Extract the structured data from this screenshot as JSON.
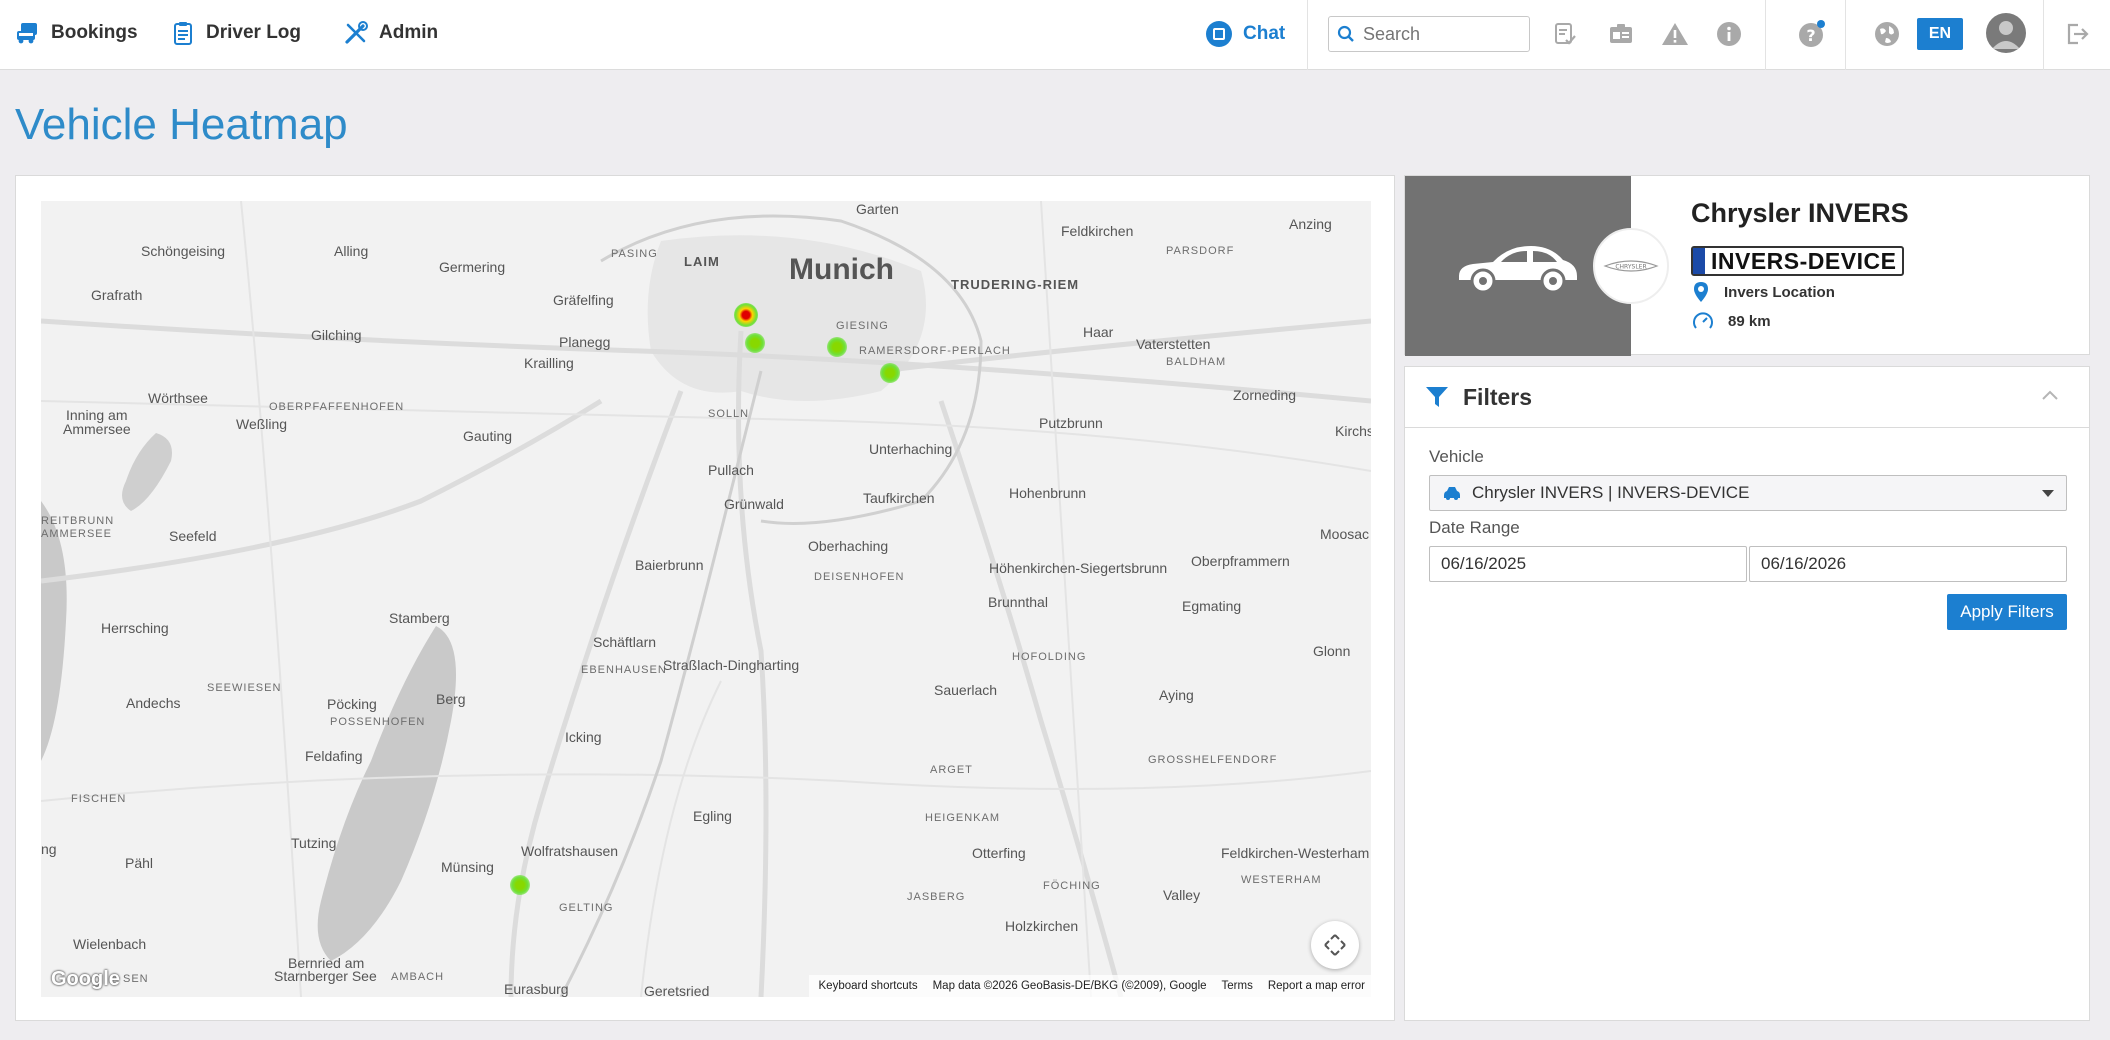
{
  "nav": {
    "bookings": "Bookings",
    "driver_log": "Driver Log",
    "admin": "Admin",
    "chat": "Chat",
    "search_placeholder": "Search",
    "language": "EN"
  },
  "page": {
    "title": "Vehicle Heatmap"
  },
  "map": {
    "city": "Munich",
    "labels": {
      "garten": "Garten",
      "feldkirchen": "Feldkirchen",
      "anzing": "Anzing",
      "schoengeising": "Schöngeising",
      "alling": "Alling",
      "germering": "Germering",
      "pasing": "PASING",
      "laim": "LAIM",
      "parsdorf": "PARSDORF",
      "trudering": "TRUDERING-RIEM",
      "grafrath": "Grafrath",
      "graefelfing": "Gräfelfing",
      "gilching": "Gilching",
      "planegg": "Planegg",
      "giesing": "GIESING",
      "haar": "Haar",
      "vaterstetten": "Vaterstetten",
      "krailling": "Krailling",
      "ramersdorf": "RAMERSDORF-PERLACH",
      "baldham": "BALDHAM",
      "woerthsee": "Wörthsee",
      "oberpfaffenhofen": "OBERPFAFFENHOFEN",
      "zorneding": "Zorneding",
      "inning": "Inning am",
      "ammersee": "Ammersee",
      "wessling": "Weßling",
      "solln": "SOLLN",
      "putzbrunn": "Putzbrunn",
      "gauting": "Gauting",
      "kirchs": "Kirchs",
      "unterhaching": "Unterhaching",
      "pullach": "Pullach",
      "taufkirchen": "Taufkirchen",
      "gruenwald": "Grünwald",
      "hohenbrunn": "Hohenbrunn",
      "reitbrunn": "REITBRUNN",
      "ammersee2": "AMMERSEE",
      "seefeld": "Seefeld",
      "moosach": "Moosac",
      "oberhaching": "Oberhaching",
      "baierbrunn": "Baierbrunn",
      "hoehenkirchen": "Höhenkirchen-Siegertsbrunn",
      "oberpframmern": "Oberpframmern",
      "deisenhofen": "DEISENHOFEN",
      "brunnthal": "Brunnthal",
      "herrsching": "Herrsching",
      "stamberg": "Stamberg",
      "egmating": "Egmating",
      "schaeftlarn": "Schäftlarn",
      "glonn": "Glonn",
      "ebenhausen": "EBENHAUSEN",
      "strasslach": "Straßlach-Dingharting",
      "hofolding": "HOFOLDING",
      "sauerlach": "Sauerlach",
      "ayning": "Aying",
      "andechs": "Andechs",
      "seewiesen": "SEEWIESEN",
      "berg": "Berg",
      "poecking": "Pöcking",
      "possenhofen": "POSSENHOFEN",
      "icking": "Icking",
      "grosshelfendorf": "GROSSHELFENDORF",
      "feldafing": "Feldafing",
      "arget": "ARGET",
      "fischen": "FISCHEN",
      "egling": "Egling",
      "heigenkam": "HEIGENKAM",
      "starnberger_see": "Starnberger See",
      "tutzing": "Tutzing",
      "otterfing": "Otterfing",
      "feldkirchen_w": "Feldkirchen-Westerham",
      "ng": "ng",
      "paehl": "Pähl",
      "muensing": "Münsing",
      "wolfratshausen": "Wolfratshausen",
      "foeching": "FÖCHING",
      "westerham": "WESTERHAM",
      "valley": "Valley",
      "jasberg": "JASBERG",
      "gelting": "GELTING",
      "wielenbach": "Wielenbach",
      "holzkirchen": "Holzkirchen",
      "bernried": "Bernried am",
      "bernried2": "Starnberger See",
      "ambach": "AMBACH",
      "sen": "SEN",
      "eurasburg": "Eurasburg",
      "geretsried": "Geretsried"
    },
    "footer": {
      "shortcuts": "Keyboard shortcuts",
      "data": "Map data ©2026 GeoBasis-DE/BKG (©2009), Google",
      "terms": "Terms",
      "report": "Report a map error"
    },
    "google": "Google"
  },
  "vehicle": {
    "name": "Chrysler INVERS",
    "plate": "INVERS-DEVICE",
    "location": "Invers Location",
    "mileage": "89 km",
    "logo_text": "CHRYSLER"
  },
  "filters": {
    "title": "Filters",
    "vehicle_label": "Vehicle",
    "vehicle_value": "Chrysler INVERS | INVERS-DEVICE",
    "date_range_label": "Date Range",
    "date_from": "06/16/2025",
    "date_to": "06/16/2026",
    "apply": "Apply Filters"
  },
  "colors": {
    "accent": "#1c7fd0",
    "title": "#2e8bc9"
  }
}
